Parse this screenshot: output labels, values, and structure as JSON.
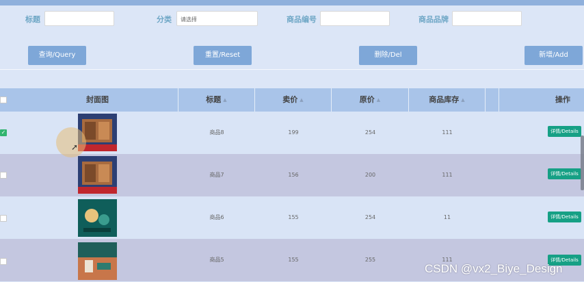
{
  "search": {
    "title_label": "标题",
    "category_label": "分类",
    "category_placeholder": "请选择",
    "code_label": "商品编号",
    "brand_label": "商品品牌"
  },
  "actions": {
    "query": "查询/Query",
    "reset": "重置/Reset",
    "delete": "删除/Del",
    "add": "新增/Add"
  },
  "table": {
    "headers": {
      "cover": "封面图",
      "title": "标题",
      "price": "卖价",
      "original_price": "原价",
      "stock": "商品库存",
      "ops": "操作"
    },
    "rows": [
      {
        "title": "商品8",
        "price": "199",
        "original_price": "254",
        "stock": "111",
        "details": "详情/Details",
        "checked": true
      },
      {
        "title": "商品7",
        "price": "156",
        "original_price": "200",
        "stock": "111",
        "details": "详情/Details",
        "checked": false
      },
      {
        "title": "商品6",
        "price": "155",
        "original_price": "254",
        "stock": "11",
        "details": "详情/Details",
        "checked": false
      },
      {
        "title": "商品5",
        "price": "155",
        "original_price": "255",
        "stock": "111",
        "details": "详情/Details",
        "checked": false
      }
    ]
  },
  "watermark": "CSDN @vx2_Biye_Design",
  "colors": {
    "accent_button": "#7ea7d8",
    "details_button": "#16a085",
    "header_bg": "#a9c4e9"
  }
}
